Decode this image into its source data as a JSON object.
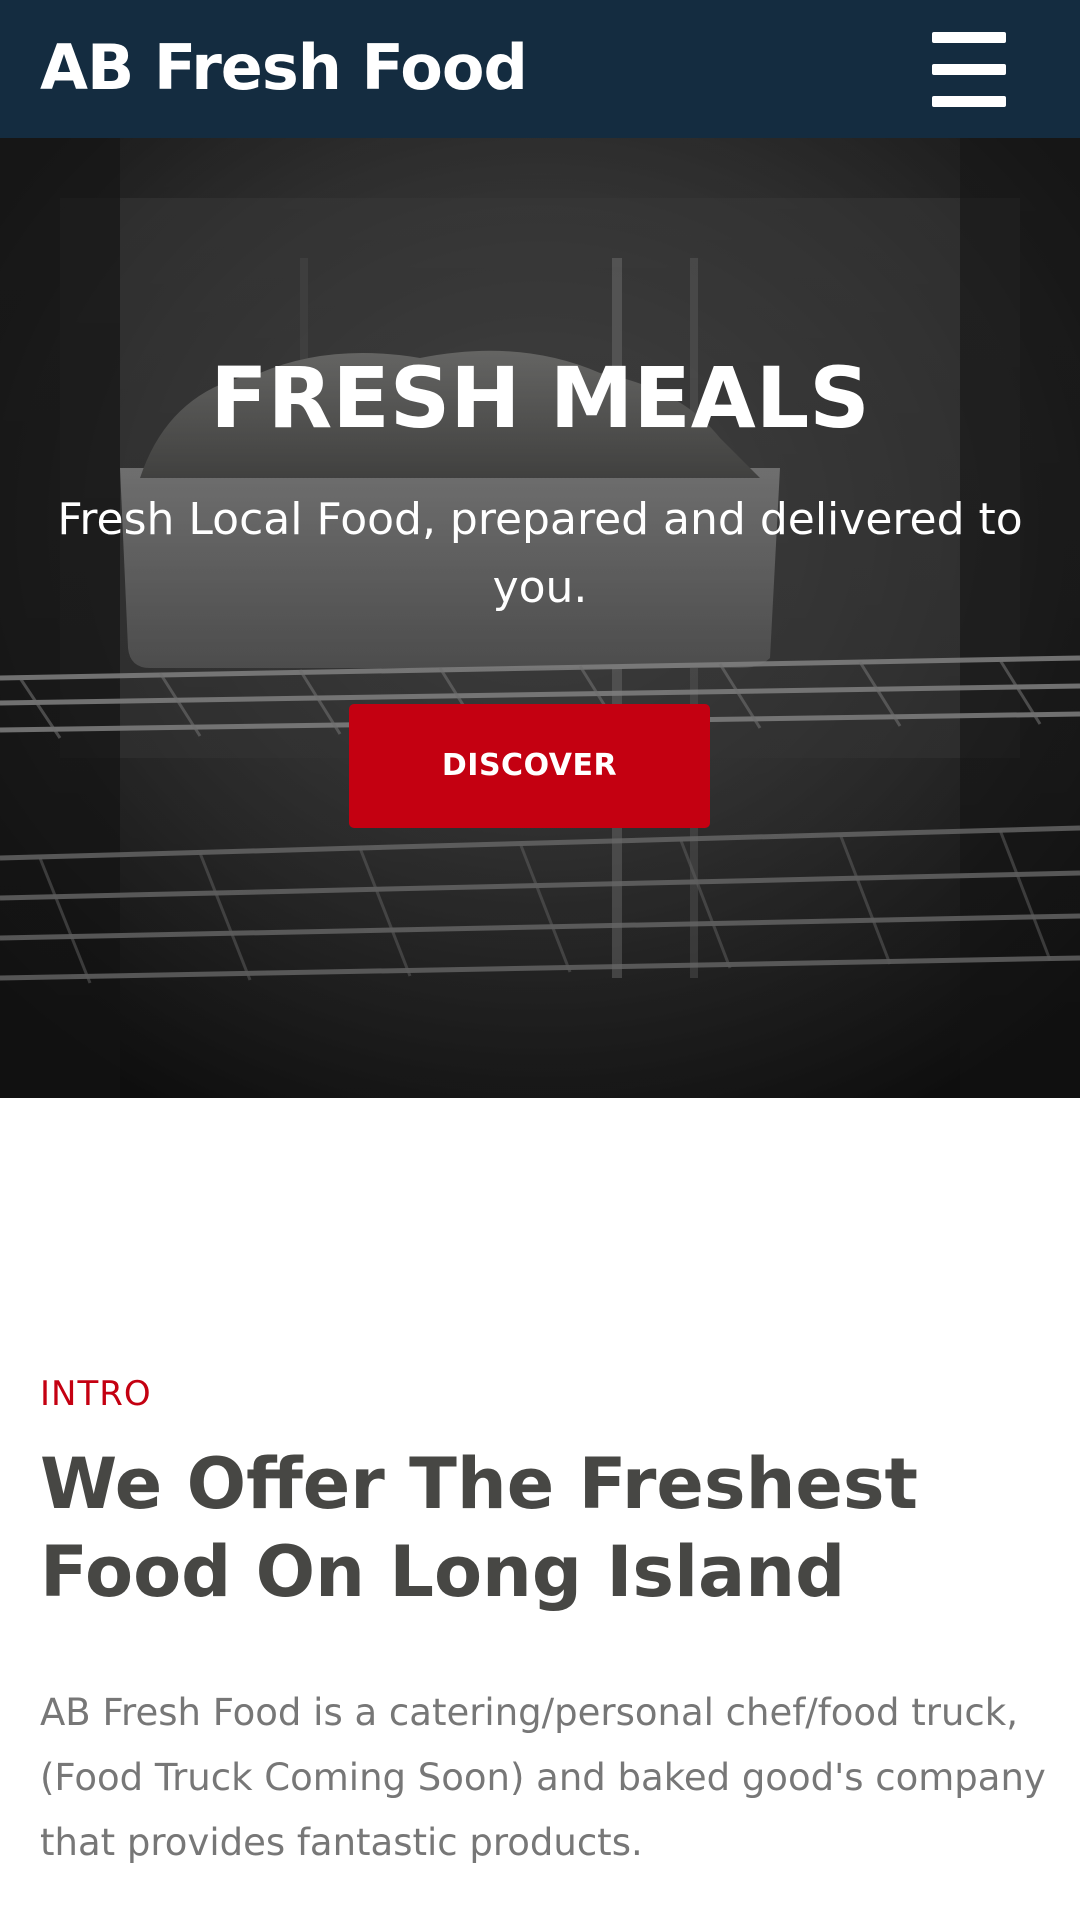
{
  "header": {
    "brand": "AB Fresh Food",
    "menu_icon": "hamburger-menu-icon",
    "background_color": "#142c40"
  },
  "hero": {
    "title": "FRESH MEALS",
    "subtitle": "Fresh Local Food, prepared and delivered to you.",
    "button_label": "DISCOVER",
    "button_color": "#c40011",
    "background_image": "bread-loaf-in-oven-photo"
  },
  "intro": {
    "eyebrow": "INTRO",
    "heading": "We Offer The Freshest Food On Long Island",
    "body": "AB Fresh Food is a catering/personal chef/food truck, (Food Truck Coming Soon) and baked good's company that provides fantastic products."
  },
  "colors": {
    "accent": "#c40011",
    "heading_text": "#474744",
    "body_text": "#777777"
  }
}
